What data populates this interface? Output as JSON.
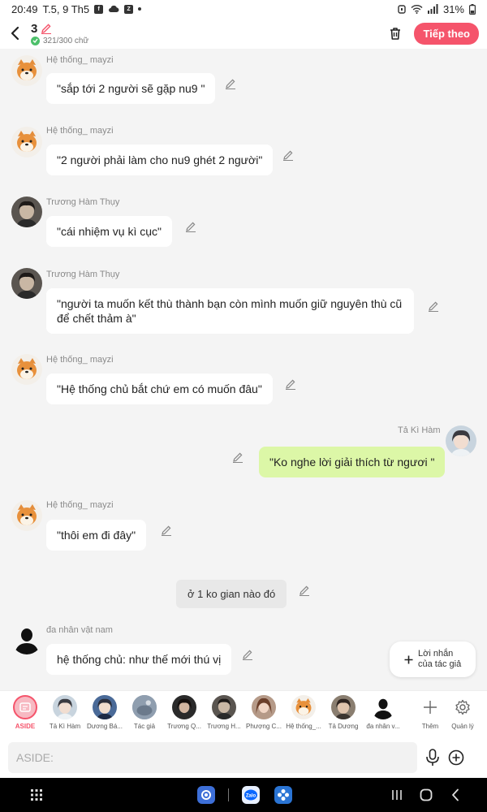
{
  "status_bar": {
    "time": "20:49",
    "date": "T.5, 9 Th5",
    "battery": "31%"
  },
  "header": {
    "title": "3",
    "word_count": "321/300 chữ",
    "next_label": "Tiếp theo"
  },
  "messages": [
    {
      "name": "Hệ thống_ mayzi",
      "text": "\"sắp tới 2 người sẽ gặp nu9 \""
    },
    {
      "name": "Hệ thống_ mayzi",
      "text": "\"2 người phải làm cho nu9 ghét 2 người\""
    },
    {
      "name": "Trương Hàm Thụy",
      "text": "\"cái nhiệm vụ kì cục\""
    },
    {
      "name": "Trương Hàm Thụy",
      "text": "\"người ta muốn kết thù thành bạn còn mình muốn giữ nguyên thù cũ để chết thảm à\""
    },
    {
      "name": "Hệ thống_ mayzi",
      "text": "\"Hệ thống chủ bắt chứ em có muốn đâu\""
    },
    {
      "name": "Tả Kì Hàm",
      "text": "\"Ko nghe lời giải thích từ ngươi \""
    },
    {
      "name": "Hệ thống_ mayzi",
      "text": "\"thôi em đi đây\""
    },
    {
      "name": "đa nhân vật nam",
      "text": "hệ thống chủ: như thế mới thú vị"
    }
  ],
  "narration": "ở 1 ko gian nào đó",
  "note_button": {
    "line1": "Lời nhắn",
    "line2": "của tác giả"
  },
  "characters": [
    {
      "label": "ASIDE"
    },
    {
      "label": "Tả Kì Hàm"
    },
    {
      "label": "Dương Bá..."
    },
    {
      "label": "Tác giả"
    },
    {
      "label": "Trương Q..."
    },
    {
      "label": "Trương H..."
    },
    {
      "label": "Phượng C..."
    },
    {
      "label": "Hệ thống_..."
    },
    {
      "label": "Tả Dương"
    },
    {
      "label": "đa nhân v..."
    },
    {
      "label": "Thêm"
    },
    {
      "label": "Quản lý"
    }
  ],
  "input": {
    "placeholder": "ASIDE:"
  },
  "colors": {
    "accent": "#f5546b",
    "my_bubble": "#dcf7a7",
    "background": "#f4f4f4"
  }
}
